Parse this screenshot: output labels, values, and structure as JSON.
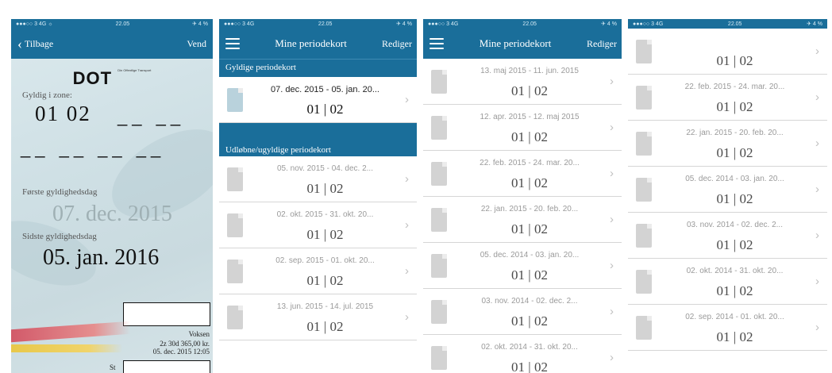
{
  "status_bar": {
    "carrier": "●●●○○ 3 4G",
    "time": "22.05",
    "battery": "✈ 4 %",
    "carrier_p1": "●●●○○ 3 4G ☼"
  },
  "ticket": {
    "back_label": "Tilbage",
    "flip_label": "Vend",
    "logo": "DOT",
    "logo_sub": "Din Offentlige Transport",
    "zone_label": "Gyldig i zone:",
    "zones": "01 02",
    "first_day_label": "Første gyldighedsdag",
    "first_day": "07. dec. 2015",
    "last_day_label": "Sidste gyldighedsdag",
    "last_day": "05. jan. 2016",
    "passenger": "Voksen",
    "price_info": "2z 30d 365,00 kr.",
    "issued": "05. dec. 2015 12:05",
    "bottom_fragment": "St"
  },
  "list": {
    "title": "Mine periodekort",
    "edit_label": "Rediger",
    "valid_header": "Gyldige periodekort",
    "expired_header": "Udløbne/ugyldige periodekort",
    "zones": "01 | 02",
    "valid_card": "07. dec. 2015 - 05. jan. 20...",
    "panel2_expired": [
      "05. nov. 2015 - 04. dec. 2...",
      "02. okt. 2015 - 31. okt. 20...",
      "02. sep. 2015 - 01. okt. 20...",
      "13. jun. 2015 - 14. jul. 2015"
    ],
    "panel3": [
      "13. maj 2015 - 11. jun. 2015",
      "12. apr. 2015 - 12. maj 2015",
      "22. feb. 2015 - 24. mar. 20...",
      "22. jan. 2015 - 20. feb. 20...",
      "05. dec. 2014 - 03. jan. 20...",
      "03. nov. 2014 - 02. dec. 2...",
      "02. okt. 2014 - 31. okt. 20..."
    ],
    "panel4": [
      "",
      "22. feb. 2015 - 24. mar. 20...",
      "22. jan. 2015 - 20. feb. 20...",
      "05. dec. 2014 - 03. jan. 20...",
      "03. nov. 2014 - 02. dec. 2...",
      "02. okt. 2014 - 31. okt. 20...",
      "02. sep. 2014 - 01. okt. 20..."
    ]
  },
  "colors": {
    "nav": "#1a6e9a"
  }
}
